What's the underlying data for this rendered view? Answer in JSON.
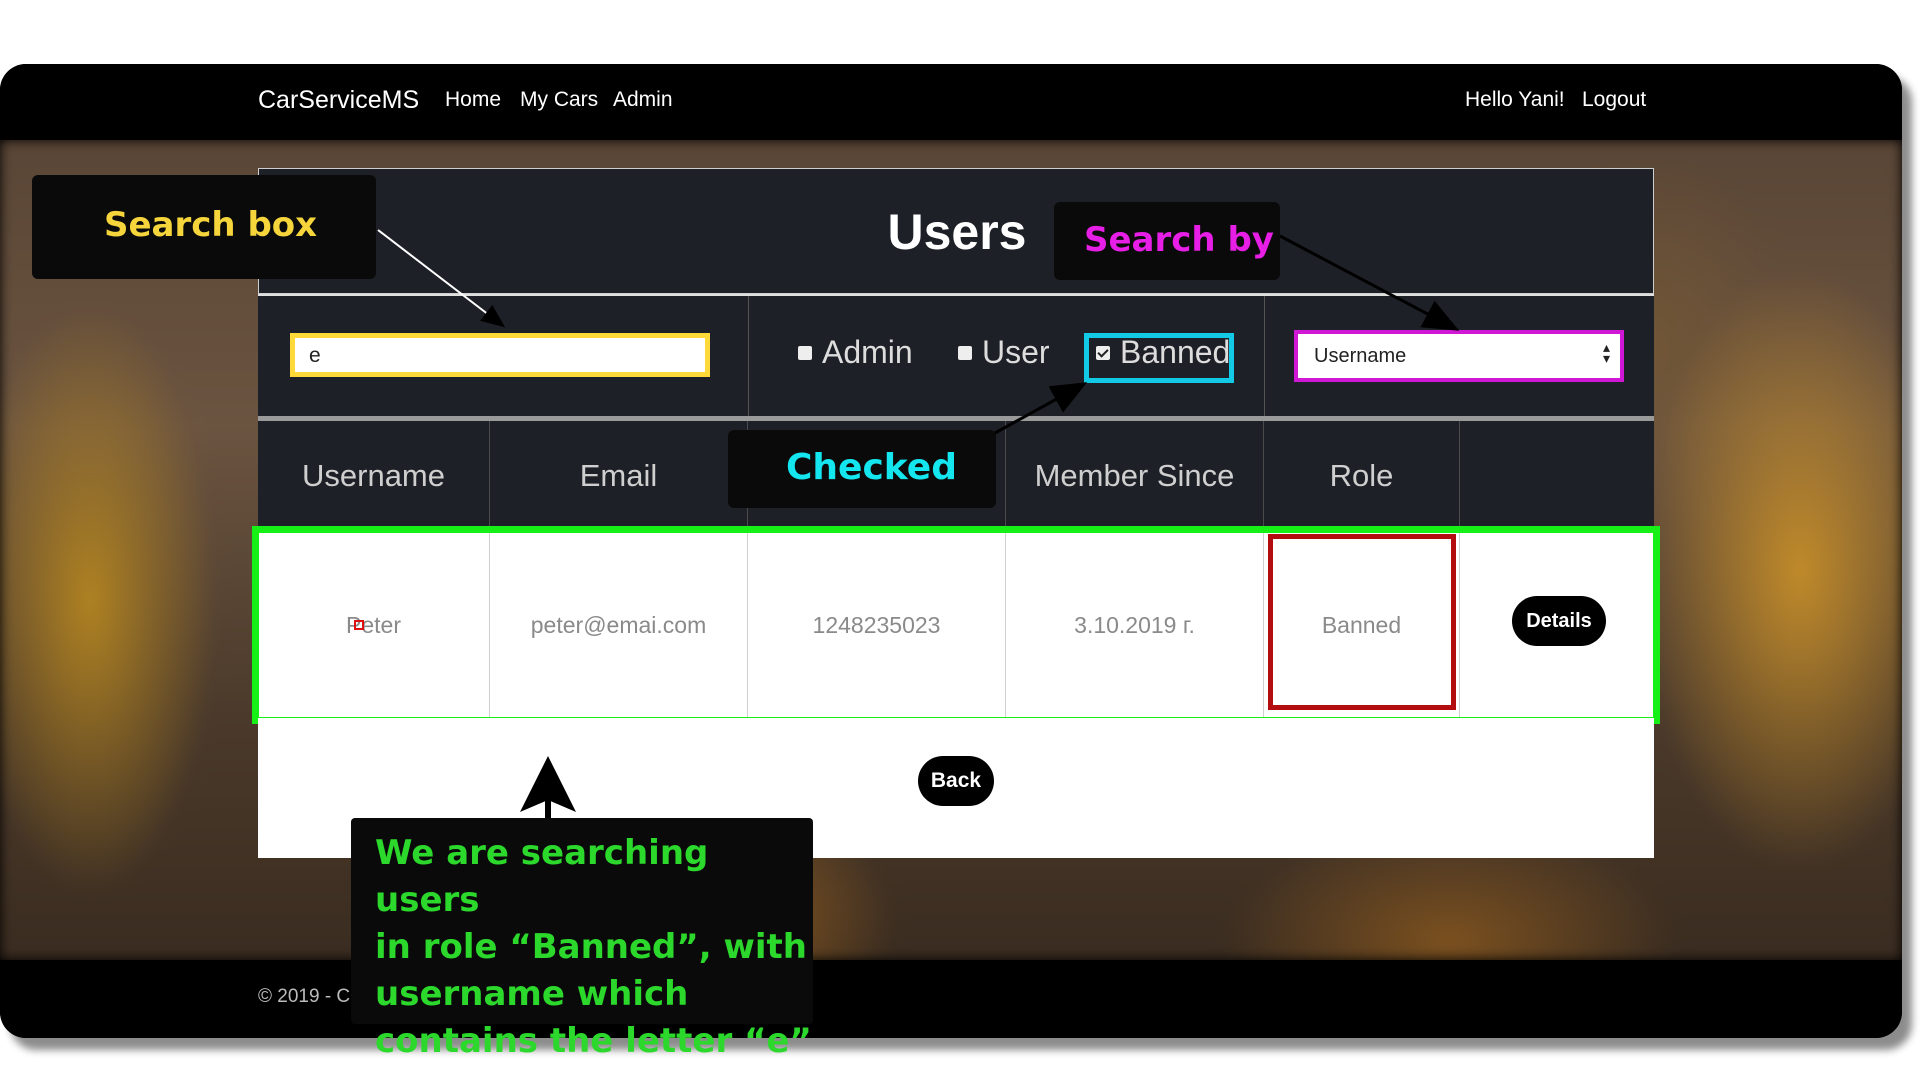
{
  "navbar": {
    "brand": "CarServiceMS",
    "links": [
      "Home",
      "My Cars",
      "Admin"
    ],
    "greeting": "Hello Yani!",
    "logout": "Logout"
  },
  "footer": {
    "text": "© 2019 - C"
  },
  "users_panel": {
    "title": "Users",
    "search": {
      "value": "e"
    },
    "role_filters": [
      {
        "label": "Admin",
        "checked": false
      },
      {
        "label": "User",
        "checked": false
      },
      {
        "label": "Banned",
        "checked": true
      }
    ],
    "search_by": {
      "selected": "Username"
    },
    "columns": [
      "Username",
      "Email",
      "",
      "Member Since",
      "Role",
      ""
    ],
    "rows": [
      {
        "username": "Peter",
        "email": "peter@emai.com",
        "phone": "1248235023",
        "member_since": "3.10.2019 г.",
        "role": "Banned",
        "action": "Details"
      }
    ],
    "back_button": "Back"
  },
  "annotations": {
    "search_box": {
      "text": "Search box",
      "color": "#f5d53b"
    },
    "search_by": {
      "text": "Search by",
      "color": "#e61ee6"
    },
    "checked": {
      "text": "Checked",
      "color": "#14e6f0"
    },
    "note": {
      "lines": [
        "We  are searching users",
        "in role “Banned”, with",
        "username which",
        "contains the letter “e”"
      ],
      "color": "#2bd82b"
    }
  },
  "colors": {
    "navbar": "#000000",
    "panel_dark": "#1e2027",
    "highlight_green": "#16f016",
    "highlight_red": "#b30d10",
    "highlight_cyan": "#12c9e6",
    "highlight_magenta": "#d117d6",
    "highlight_yellow": "#ffd83a"
  }
}
